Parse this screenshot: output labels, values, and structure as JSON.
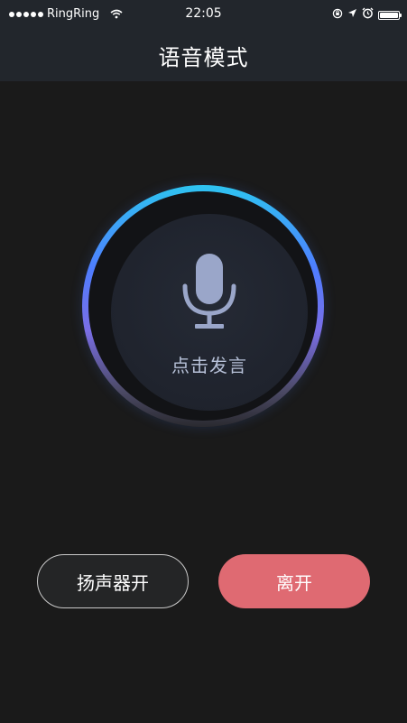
{
  "status_bar": {
    "carrier": "RingRing",
    "time": "22:05"
  },
  "nav": {
    "title": "语音模式"
  },
  "mic": {
    "label": "点击发言",
    "icon": "microphone-icon"
  },
  "buttons": {
    "speaker_label": "扬声器开",
    "leave_label": "离开"
  },
  "colors": {
    "background": "#1a1a1a",
    "nav_background": "#22262c",
    "ring_top": "#2ec4f1",
    "ring_mid": "#4f7dff",
    "leave_button": "#df6a72",
    "mic_icon": "#9aa6c9"
  }
}
